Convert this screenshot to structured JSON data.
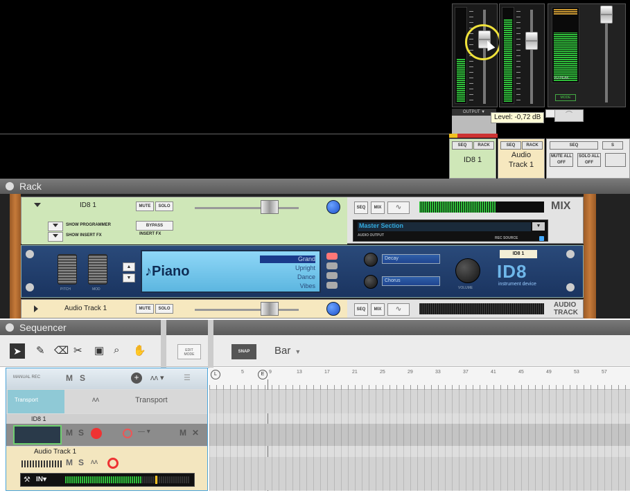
{
  "mixer": {
    "tooltip": "Level: -0,72 dB",
    "output_label": "OUTPUT ▼",
    "channel1": {
      "name": "ID8 1",
      "seq": "SEQ",
      "rack": "RACK"
    },
    "channel2": {
      "name_line1": "Audio",
      "name_line2": "Track 1",
      "seq": "SEQ",
      "rack": "RACK"
    },
    "master": {
      "seq": "SEQ",
      "mute_all": "MUTE ALL OFF",
      "solo_all": "SOLO ALL OFF",
      "vu_label": "VU PEAK",
      "mode_label": "MODE"
    },
    "colors": {
      "channel1_bg": "#cfe7b8",
      "channel2_bg": "#f6e8bf",
      "highlight_circle": "#f0e23a"
    }
  },
  "rack": {
    "title": "Rack",
    "mixer_channel1": {
      "name": "ID8 1",
      "mute": "MUTE",
      "solo": "SOLO",
      "show_programmer": "SHOW PROGRAMMER",
      "show_insert_fx": "SHOW INSERT FX",
      "bypass": "BYPASS",
      "insert_fx": "INSERT FX",
      "seq": "SEQ",
      "mix": "MIX",
      "badge": "MIX"
    },
    "master_section": {
      "title": "Master Section",
      "audio_output": "AUDIO OUTPUT",
      "rec_source": "REC SOURCE"
    },
    "id8": {
      "patch": "♪Piano",
      "categories": [
        "Grand",
        "Upright",
        "Dance",
        "Vibes"
      ],
      "selected_category": "Grand",
      "param1": "Decay",
      "param2": "Chorus",
      "knob_label": "VOLUME",
      "logo": "ID8",
      "subtitle": "instrument device",
      "name_label": "ID8 1",
      "pitch_label": "PITCH",
      "mod_label": "MOD"
    },
    "audio_track": {
      "name": "Audio Track 1",
      "mute": "MUTE",
      "solo": "SOLO",
      "seq": "SEQ",
      "mix": "MIX",
      "badge_line1": "AUDIO",
      "badge_line2": "TRACK"
    }
  },
  "sequencer": {
    "title": "Sequencer",
    "edit_mode_line1": "EDIT",
    "edit_mode_line2": "MODE",
    "snap": "SNAP",
    "snap_value": "Bar",
    "manual_rec": "MANUAL REC",
    "m": "M",
    "s": "S",
    "ruler": [
      "1",
      "5",
      "9",
      "13",
      "17",
      "21",
      "25",
      "29",
      "33",
      "37",
      "41",
      "45",
      "49",
      "53",
      "57"
    ],
    "tracks": [
      {
        "name": "Transport",
        "sub": "Transport"
      },
      {
        "name": "ID8 1"
      },
      {
        "name": "Audio Track 1",
        "input": "IN▾"
      }
    ]
  }
}
